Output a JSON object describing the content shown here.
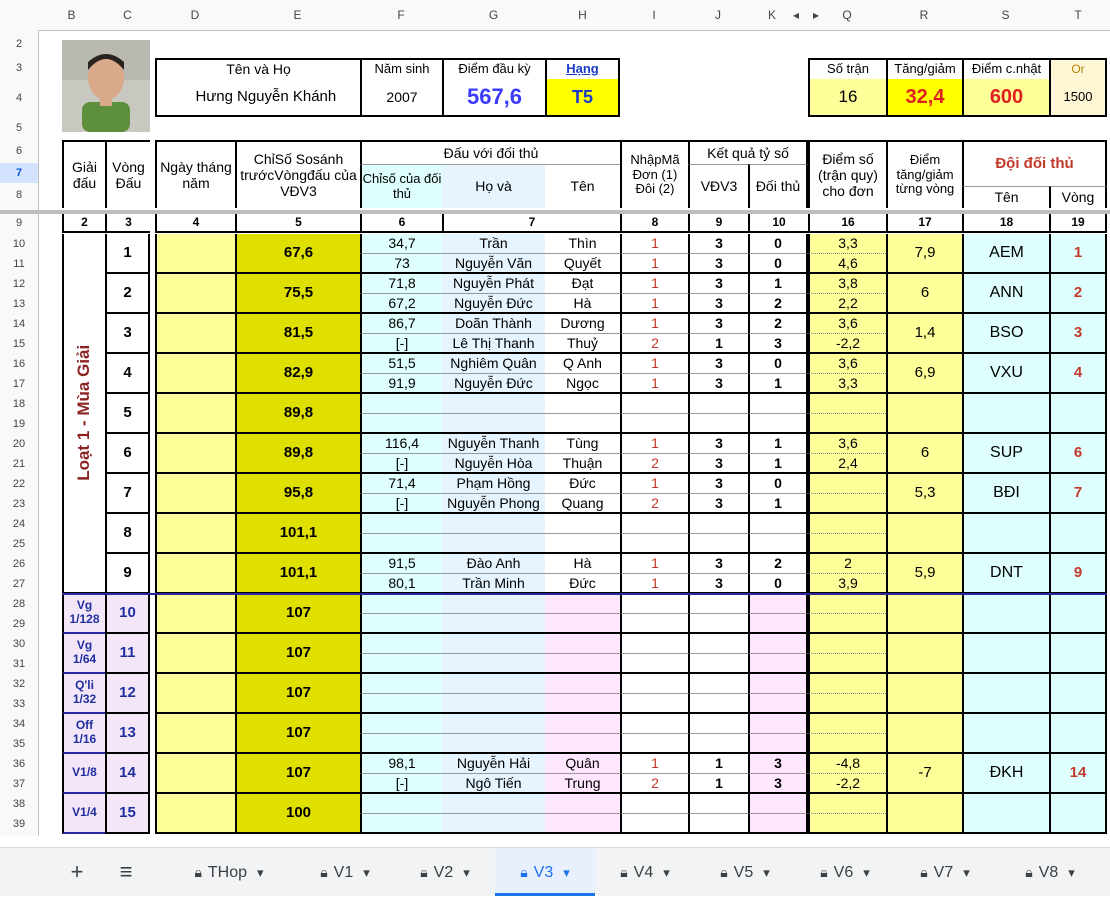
{
  "column_headers": [
    "B",
    "C",
    "D",
    "E",
    "F",
    "G",
    "H",
    "I",
    "J",
    "K",
    "Q",
    "R",
    "S",
    "T"
  ],
  "row_numbers": [
    "2",
    "3",
    "4",
    "5",
    "6",
    "7",
    "8",
    "9",
    "10",
    "11",
    "12",
    "13",
    "14",
    "15",
    "16",
    "17",
    "18",
    "19",
    "20",
    "21",
    "22",
    "23",
    "24",
    "25",
    "26",
    "27",
    "28",
    "29",
    "30",
    "31",
    "32",
    "33",
    "34",
    "35",
    "36",
    "37",
    "38",
    "39"
  ],
  "player": {
    "name_label": "Tên    và    Họ",
    "first_name": "Hưng",
    "last_name": "Nguyễn Khánh",
    "birth_label": "Năm sinh",
    "birth_year": "2007",
    "score_label": "Điểm đầu kỳ",
    "score": "567,6",
    "rank_label": "Hạng",
    "rank": "T5"
  },
  "summary": {
    "matches_label": "Số trận",
    "matches": "16",
    "delta_label": "Tăng/giảm",
    "delta": "32,4",
    "updated_label": "Điểm c.nhật",
    "updated": "600",
    "or_label": "Or",
    "or_value": "1500"
  },
  "headers": {
    "giai": "Giải đấu",
    "vong": "Vòng Đấu",
    "ngay": "Ngày tháng năm",
    "chiso": "ChỉSố Sosánh trướcVòngđấu của VĐV3",
    "doithu": "Đấu với đối thủ",
    "chiso_doithu": "Chỉsố của đối thủ",
    "ho": "Họ    và",
    "ten": "Tên",
    "nhapma": "NhậpMã Đơn (1) Đôi (2)",
    "ketqua": "Kết quả tỷ số",
    "vdv3": "VĐV3",
    "doi_thu": "Đối thủ",
    "diemso": "Điểm số (trận quy) cho đơn",
    "diem_tang": "Điểm tăng/giảm từng vòng",
    "doi_doi_thu": "Đội đối thủ",
    "ten_doi": "Tên",
    "vong_doi": "Vòng"
  },
  "col_numbers": [
    "2",
    "3",
    "4",
    "5",
    "6",
    "7",
    "8",
    "9",
    "10",
    "16",
    "17",
    "18",
    "19"
  ],
  "season_label": "Loạt 1 - Mùa Giải",
  "rounds": [
    {
      "round": "1",
      "idx": "67,6",
      "opp": [
        {
          "cs": "34,7",
          "ho": "Trần",
          "ten": "Thìn",
          "ma": "1",
          "a": "3",
          "b": "0",
          "d": "3,3"
        },
        {
          "cs": "73",
          "ho": "Nguyễn Văn",
          "ten": "Quyết",
          "ma": "1",
          "a": "3",
          "b": "0",
          "d": "4,6"
        }
      ],
      "delta": "7,9",
      "team": "AEM",
      "tv": "1"
    },
    {
      "round": "2",
      "idx": "75,5",
      "opp": [
        {
          "cs": "71,8",
          "ho": "Nguyễn Phát",
          "ten": "Đạt",
          "ma": "1",
          "a": "3",
          "b": "1",
          "d": "3,8"
        },
        {
          "cs": "67,2",
          "ho": "Nguyễn Đức",
          "ten": "Hà",
          "ma": "1",
          "a": "3",
          "b": "2",
          "d": "2,2"
        }
      ],
      "delta": "6",
      "team": "ANN",
      "tv": "2"
    },
    {
      "round": "3",
      "idx": "81,5",
      "opp": [
        {
          "cs": "86,7",
          "ho": "Doãn Thành",
          "ten": "Dương",
          "ma": "1",
          "a": "3",
          "b": "2",
          "d": "3,6"
        },
        {
          "cs": "[-]",
          "ho": "Lê Thị Thanh",
          "ten": "Thuỷ",
          "ma": "2",
          "a": "1",
          "b": "3",
          "d": "-2,2"
        }
      ],
      "delta": "1,4",
      "team": "BSO",
      "tv": "3"
    },
    {
      "round": "4",
      "idx": "82,9",
      "opp": [
        {
          "cs": "51,5",
          "ho": "Nghiêm Quân",
          "ten": "Q Anh",
          "ma": "1",
          "a": "3",
          "b": "0",
          "d": "3,6"
        },
        {
          "cs": "91,9",
          "ho": "Nguyễn Đức",
          "ten": "Ngọc",
          "ma": "1",
          "a": "3",
          "b": "1",
          "d": "3,3"
        }
      ],
      "delta": "6,9",
      "team": "VXU",
      "tv": "4"
    },
    {
      "round": "5",
      "idx": "89,8",
      "opp": [
        {
          "cs": "",
          "ho": "",
          "ten": "",
          "ma": "",
          "a": "",
          "b": "",
          "d": ""
        },
        {
          "cs": "",
          "ho": "",
          "ten": "",
          "ma": "",
          "a": "",
          "b": "",
          "d": ""
        }
      ],
      "delta": "",
      "team": "",
      "tv": ""
    },
    {
      "round": "6",
      "idx": "89,8",
      "opp": [
        {
          "cs": "116,4",
          "ho": "Nguyễn Thanh",
          "ten": "Tùng",
          "ma": "1",
          "a": "3",
          "b": "1",
          "d": "3,6"
        },
        {
          "cs": "[-]",
          "ho": "Nguyễn Hòa",
          "ten": "Thuận",
          "ma": "2",
          "a": "3",
          "b": "1",
          "d": "2,4"
        }
      ],
      "delta": "6",
      "team": "SUP",
      "tv": "6"
    },
    {
      "round": "7",
      "idx": "95,8",
      "opp": [
        {
          "cs": "71,4",
          "ho": "Phạm Hồng",
          "ten": "Đức",
          "ma": "1",
          "a": "3",
          "b": "0",
          "d": ""
        },
        {
          "cs": "[-]",
          "ho": "Nguyễn Phong",
          "ten": "Quang",
          "ma": "2",
          "a": "3",
          "b": "1",
          "d": ""
        }
      ],
      "delta": "5,3",
      "team": "BĐI",
      "tv": "7"
    },
    {
      "round": "8",
      "idx": "101,1",
      "opp": [
        {
          "cs": "",
          "ho": "",
          "ten": "",
          "ma": "",
          "a": "",
          "b": "",
          "d": ""
        },
        {
          "cs": "",
          "ho": "",
          "ten": "",
          "ma": "",
          "a": "",
          "b": "",
          "d": ""
        }
      ],
      "delta": "",
      "team": "",
      "tv": ""
    },
    {
      "round": "9",
      "idx": "101,1",
      "opp": [
        {
          "cs": "91,5",
          "ho": "Đào Anh",
          "ten": "Hà",
          "ma": "1",
          "a": "3",
          "b": "2",
          "d": "2"
        },
        {
          "cs": "80,1",
          "ho": "Trần Minh",
          "ten": "Đức",
          "ma": "1",
          "a": "3",
          "b": "0",
          "d": "3,9"
        }
      ],
      "delta": "5,9",
      "team": "DNT",
      "tv": "9"
    },
    {
      "stage": "Vg 1/128",
      "round": "10",
      "idx": "107",
      "opp": [
        {
          "cs": "",
          "ho": "",
          "ten": "",
          "ma": "",
          "a": "",
          "b": "",
          "d": ""
        },
        {
          "cs": "",
          "ho": "",
          "ten": "",
          "ma": "",
          "a": "",
          "b": "",
          "d": ""
        }
      ],
      "delta": "",
      "team": "",
      "tv": ""
    },
    {
      "stage": "Vg 1/64",
      "round": "11",
      "idx": "107",
      "opp": [
        {
          "cs": "",
          "ho": "",
          "ten": "",
          "ma": "",
          "a": "",
          "b": "",
          "d": ""
        },
        {
          "cs": "",
          "ho": "",
          "ten": "",
          "ma": "",
          "a": "",
          "b": "",
          "d": ""
        }
      ],
      "delta": "",
      "team": "",
      "tv": ""
    },
    {
      "stage": "Q'li 1/32",
      "round": "12",
      "idx": "107",
      "opp": [
        {
          "cs": "",
          "ho": "",
          "ten": "",
          "ma": "",
          "a": "",
          "b": "",
          "d": ""
        },
        {
          "cs": "",
          "ho": "",
          "ten": "",
          "ma": "",
          "a": "",
          "b": "",
          "d": ""
        }
      ],
      "delta": "",
      "team": "",
      "tv": ""
    },
    {
      "stage": "Off 1/16",
      "round": "13",
      "idx": "107",
      "opp": [
        {
          "cs": "",
          "ho": "",
          "ten": "",
          "ma": "",
          "a": "",
          "b": "",
          "d": ""
        },
        {
          "cs": "",
          "ho": "",
          "ten": "",
          "ma": "",
          "a": "",
          "b": "",
          "d": ""
        }
      ],
      "delta": "",
      "team": "",
      "tv": ""
    },
    {
      "stage": "V1/8",
      "round": "14",
      "idx": "107",
      "opp": [
        {
          "cs": "98,1",
          "ho": "Nguyễn Hải",
          "ten": "Quân",
          "ma": "1",
          "a": "1",
          "b": "3",
          "d": "-4,8"
        },
        {
          "cs": "[-]",
          "ho": "Ngô Tiến",
          "ten": "Trung",
          "ma": "2",
          "a": "1",
          "b": "3",
          "d": "-2,2"
        }
      ],
      "delta": "-7",
      "team": "ĐKH",
      "tv": "14"
    },
    {
      "stage": "V1/4",
      "round": "15",
      "idx": "100",
      "opp": [
        {
          "cs": "",
          "ho": "",
          "ten": "",
          "ma": "",
          "a": "",
          "b": "",
          "d": ""
        },
        {
          "cs": "",
          "ho": "",
          "ten": "",
          "ma": "",
          "a": "",
          "b": "",
          "d": ""
        }
      ],
      "delta": "",
      "team": "",
      "tv": ""
    }
  ],
  "tabs": {
    "add": "+",
    "menu": "≡",
    "items": [
      "THop",
      "V1",
      "V2",
      "V3",
      "V4",
      "V5",
      "V6",
      "V7",
      "V8"
    ],
    "active": "V3"
  },
  "colors": {
    "yellow": "#ffff99",
    "olive": "#e0e000",
    "cyan": "#dfffff",
    "pink": "#ffe6ff",
    "lavender": "#f3e6f8",
    "blue_text": "#3c3cff",
    "red_text": "#c0392b",
    "rank_bg": "#ffff00"
  }
}
